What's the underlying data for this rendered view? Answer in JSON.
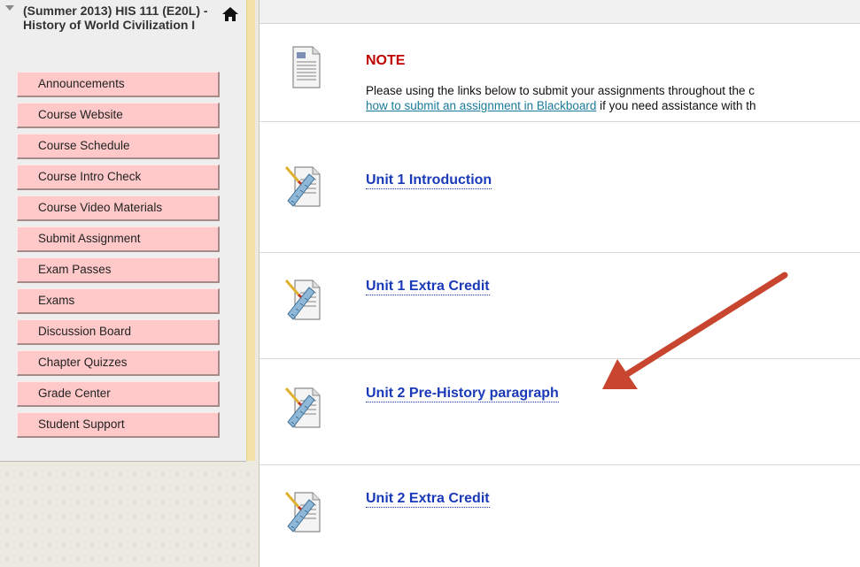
{
  "course_menu": {
    "title": "(Summer 2013) HIS 111 (E20L) - History of World Civilization I",
    "collapse_icon": "triangle-down-icon",
    "home_icon": "home-icon",
    "items": [
      {
        "label": "Announcements"
      },
      {
        "label": "Course Website"
      },
      {
        "label": "Course Schedule"
      },
      {
        "label": "Course Intro Check"
      },
      {
        "label": "Course Video Materials"
      },
      {
        "label": "Submit Assignment"
      },
      {
        "label": "Exam Passes"
      },
      {
        "label": "Exams"
      },
      {
        "label": "Discussion Board"
      },
      {
        "label": "Chapter Quizzes"
      },
      {
        "label": "Grade Center"
      },
      {
        "label": "Student Support"
      }
    ],
    "button_color": "#ffc9c9"
  },
  "content": {
    "note": {
      "title": "NOTE",
      "text_before": "Please using the links below to submit your assignments throughout the c",
      "link_text": "how to submit an assignment in Blackboard",
      "text_after": " if you need assistance with th",
      "icon": "document-icon"
    },
    "items": [
      {
        "title": "Unit 1 Introduction",
        "icon": "assignment-icon"
      },
      {
        "title": "Unit 1 Extra Credit",
        "icon": "assignment-icon"
      },
      {
        "title": "Unit 2 Pre-History paragraph",
        "icon": "assignment-icon"
      },
      {
        "title": "Unit 2 Extra Credit",
        "icon": "assignment-icon"
      }
    ],
    "title_color": "#1b3ab8",
    "note_title_color": "#c00000"
  },
  "annotation": {
    "arrow_color": "#c8452f"
  }
}
